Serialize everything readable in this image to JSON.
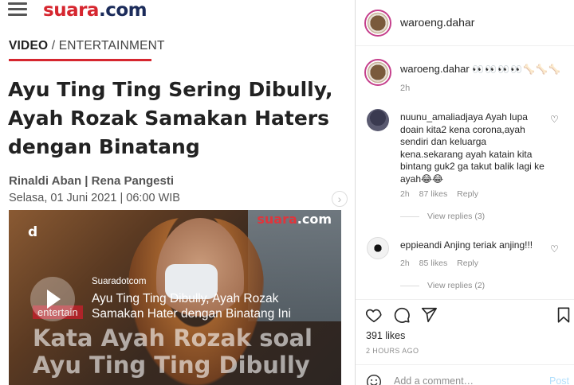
{
  "article": {
    "logo_part1": "suara",
    "logo_part2": ".com",
    "category_primary": "VIDEO",
    "category_rest": " / ENTERTAINMENT",
    "headline": "Ayu Ting Ting Sering Dibully, Ayah Rozak Samakan Haters dengan Binatang",
    "authors": "Rinaldi Aban | Rena Pangesti",
    "date": "Selasa, 01 Juni 2021 | 06:00 WIB",
    "video": {
      "logo_part1": "suara",
      "logo_part2": ".com",
      "mark": "d",
      "source": "Suaradotcom",
      "title": "Ayu Ting Ting Dibully, Ayah Rozak Samakan Hater dengan Binatang Ini",
      "badge": "entertain",
      "overlay_text": "Kata Ayah Rozak soal Ayu Ting Ting Dibully"
    }
  },
  "instagram": {
    "account": "waroeng.dahar",
    "caption": {
      "username": "waroeng.dahar",
      "emoji": "👀👀👀👀🦴🦴🦴",
      "time": "2h"
    },
    "comments": [
      {
        "username": "nuunu_amaliadjaya",
        "text": "Ayah lupa doain kita2 kena corona,ayah sendiri dan keluarga kena.sekarang ayah katain kita bintang guk2 ga takut balik lagi ke ayah😂😂",
        "time": "2h",
        "likes": "87 likes",
        "reply": "Reply",
        "view_replies": "View replies (3)"
      },
      {
        "username": "eppieandi",
        "text": "Anjing teriak anjing!!!",
        "time": "2h",
        "likes": "85 likes",
        "reply": "Reply",
        "view_replies": "View replies (2)"
      }
    ],
    "likes": "391 likes",
    "posted_ago": "2 HOURS AGO",
    "add_comment_placeholder": "Add a comment…",
    "post_label": "Post",
    "colors": {
      "post_disabled": "#b2dffc",
      "muted": "#8e8e8e",
      "brand_red": "#d6262f"
    }
  }
}
